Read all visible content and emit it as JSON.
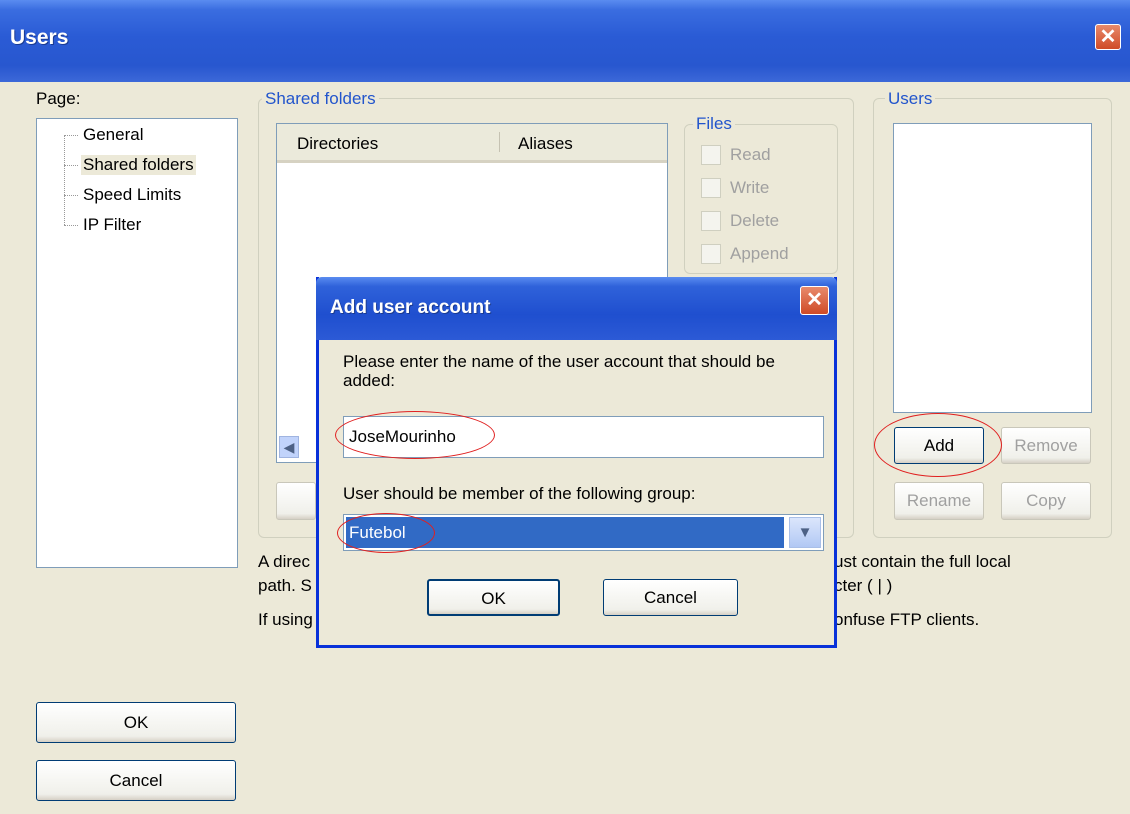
{
  "window": {
    "title": "Users"
  },
  "page_label": "Page:",
  "tree": [
    "General",
    "Shared folders",
    "Speed Limits",
    "IP Filter"
  ],
  "shared_folders": {
    "title": "Shared folders",
    "columns": [
      "Directories",
      "Aliases"
    ]
  },
  "files": {
    "title": "Files",
    "options": [
      "Read",
      "Write",
      "Delete",
      "Append"
    ]
  },
  "users_panel": {
    "title": "Users",
    "add": "Add",
    "remove": "Remove",
    "rename": "Rename",
    "copy": "Copy"
  },
  "info": {
    "line1_left": "A direc",
    "line1_right": "ust contain the full local",
    "line2_left": "path. S",
    "line2_right": "cter ( | )",
    "line3_left": "If using",
    "line3_right": "onfuse FTP clients."
  },
  "main_buttons": {
    "ok": "OK",
    "cancel": "Cancel"
  },
  "dialog": {
    "title": "Add user account",
    "prompt": "Please enter the name of the user account that should be added:",
    "username": "JoseMourinho",
    "group_label": "User should be member of the following group:",
    "group_selected": "Futebol",
    "ok": "OK",
    "cancel": "Cancel"
  },
  "colors": {
    "titlebar": "#2857cf",
    "face": "#ece9d8",
    "selection": "#316ac5",
    "annotation": "#e02020"
  }
}
